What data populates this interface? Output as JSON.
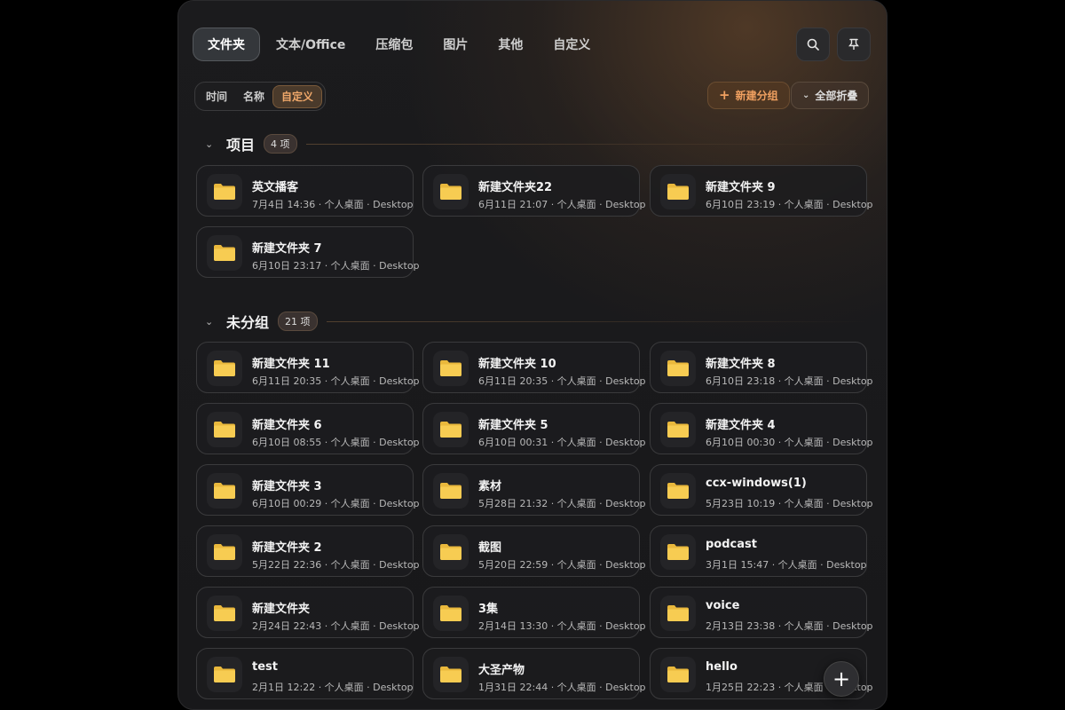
{
  "tabs": [
    {
      "label": "文件夹",
      "active": true
    },
    {
      "label": "文本/Office",
      "active": false
    },
    {
      "label": "压缩包",
      "active": false
    },
    {
      "label": "图片",
      "active": false
    },
    {
      "label": "其他",
      "active": false
    },
    {
      "label": "自定义",
      "active": false
    }
  ],
  "toolbar": {
    "search_icon": "search-icon",
    "pin_icon": "pin-icon"
  },
  "sort": {
    "items": [
      {
        "label": "时间",
        "active": false
      },
      {
        "label": "名称",
        "active": false
      },
      {
        "label": "自定义",
        "active": true
      }
    ]
  },
  "actions": {
    "new_group_label": "新建分组",
    "collapse_all_label": "全部折叠"
  },
  "groups": [
    {
      "title": "项目",
      "count": "4 项",
      "items": [
        {
          "name": "英文播客",
          "meta": "7月4日 14:36 · 个人桌面 · Desktop"
        },
        {
          "name": "新建文件夹22",
          "meta": "6月11日 21:07 · 个人桌面 · Desktop"
        },
        {
          "name": "新建文件夹 9",
          "meta": "6月10日 23:19 · 个人桌面 · Desktop"
        },
        {
          "name": "新建文件夹 7",
          "meta": "6月10日 23:17 · 个人桌面 · Desktop"
        }
      ]
    },
    {
      "title": "未分组",
      "count": "21 项",
      "items": [
        {
          "name": "新建文件夹 11",
          "meta": "6月11日 20:35 · 个人桌面 · Desktop"
        },
        {
          "name": "新建文件夹 10",
          "meta": "6月11日 20:35 · 个人桌面 · Desktop"
        },
        {
          "name": "新建文件夹 8",
          "meta": "6月10日 23:18 · 个人桌面 · Desktop"
        },
        {
          "name": "新建文件夹 6",
          "meta": "6月10日 08:55 · 个人桌面 · Desktop"
        },
        {
          "name": "新建文件夹 5",
          "meta": "6月10日 00:31 · 个人桌面 · Desktop"
        },
        {
          "name": "新建文件夹 4",
          "meta": "6月10日 00:30 · 个人桌面 · Desktop"
        },
        {
          "name": "新建文件夹 3",
          "meta": "6月10日 00:29 · 个人桌面 · Desktop"
        },
        {
          "name": "素材",
          "meta": "5月28日 21:32 · 个人桌面 · Desktop"
        },
        {
          "name": "ccx-windows(1)",
          "meta": "5月23日 10:19 · 个人桌面 · Desktop"
        },
        {
          "name": "新建文件夹 2",
          "meta": "5月22日 22:36 · 个人桌面 · Desktop"
        },
        {
          "name": "截图",
          "meta": "5月20日 22:59 · 个人桌面 · Desktop"
        },
        {
          "name": "podcast",
          "meta": "3月1日 15:47 · 个人桌面 · Desktop"
        },
        {
          "name": "新建文件夹",
          "meta": "2月24日 22:43 · 个人桌面 · Desktop"
        },
        {
          "name": "3集",
          "meta": "2月14日 13:30 · 个人桌面 · Desktop"
        },
        {
          "name": "voice",
          "meta": "2月13日 23:38 · 个人桌面 · Desktop"
        },
        {
          "name": "test",
          "meta": "2月1日 12:22 · 个人桌面 · Desktop"
        },
        {
          "name": "大圣产物",
          "meta": "1月31日 22:44 · 个人桌面 · Desktop"
        },
        {
          "name": "hello",
          "meta": "1月25日 22:23 · 个人桌面 · Desktop"
        }
      ]
    }
  ],
  "fab": {
    "label": "+"
  },
  "colors": {
    "accent": "#f0a060",
    "folder": "#f7c948",
    "background": "#1b1b1d"
  }
}
